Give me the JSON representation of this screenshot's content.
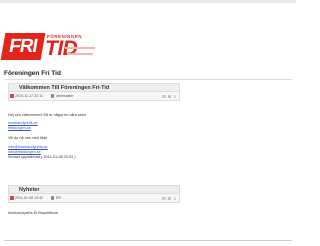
{
  "logo": {
    "fri": "FRI",
    "foreningen": "FÖRENINGEN",
    "tid": "TID"
  },
  "page_title": "Föreningen Fri Tid",
  "posts": [
    {
      "title": "Välkommen Till Föreningen Fri-Tid",
      "date": "2010-11-17 22:11",
      "author": "webmaster",
      "tools": "⊟ ✉ ⇩"
    },
    {
      "title": "Nyheter",
      "date": "2011-01-08 19:42",
      "author": "ER",
      "tools": "⊟ ✉ ⇩"
    }
  ],
  "post1_body": {
    "intro": "Hej och välkommen! Ett är något en våra sidor",
    "link1": "innebandyrelis.se",
    "link2": "fritidungen.se",
    "line3": "Vill du nå oss med Mail",
    "link3": "info@innebandyrelis.se",
    "link4": "info@fritidungen.se",
    "updated": "Senast uppdaterad ( 2011-01-08 20:03 )"
  },
  "post2_body": {
    "text": "Innebandyrelis Et Bopolitikum"
  }
}
